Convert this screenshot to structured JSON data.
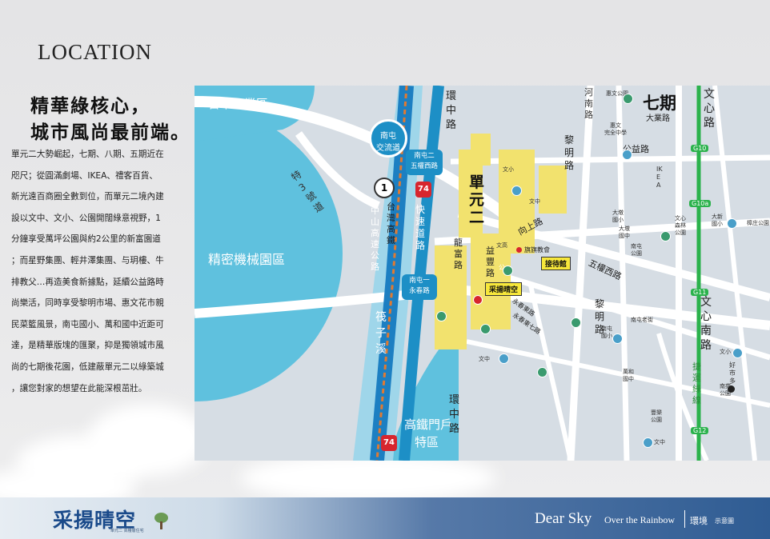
{
  "page": {
    "title": "LOCATION",
    "headline_1": "精華綠核心，",
    "headline_2": "城市風尚最前端。",
    "body_lines": [
      "單元二大勢崛起，七期、八期、五期近在",
      "咫尺；從圓滿劇場、IKEA、禮客百貨、",
      "新光遠百商圈全數到位，而單元二境內建",
      "設以文中、文小、公園開闊綠意視野，1",
      "分鐘享受萬坪公園與約2公里的新富園道",
      "；而星野集團、輕井澤集團、与玥樓、牛",
      "排教父…再造美食新據點，延續公益路時",
      "尚樂活，同時享受黎明市場、惠文花市親",
      "民菜籃風景，南屯國小、萬和國中近距可",
      "達，是精華版塊的匯聚，抑是獨領城市風",
      "尚的七期後花園，低建蔽單元二以綠築城",
      "，讓您對家的想望在此能深根茁壯。"
    ]
  },
  "map": {
    "zones": {
      "industrial": "台中工業區",
      "machinery": "精密機械園區",
      "hsr": "高鐵門戶",
      "hsr_2": "特區",
      "unit2": "單元二",
      "phase7": "七期"
    },
    "interchange": [
      "南屯",
      "交流道"
    ],
    "roads": {
      "special3": "特3號道",
      "zhongshan": "中山高速公路",
      "hsr_line": "台灣高鐵",
      "expressway": "快速道路",
      "huanzhong": "環中路",
      "huanzhong_lower": "環中路",
      "henan": "河南路",
      "wuquan_w": "五權西路",
      "liming": "黎明路",
      "wenxin_top": "文心路",
      "wenxin_bottom": "文心南路",
      "metro": "捷運綠線",
      "gongyi": "公益路",
      "dadun": "大業路",
      "xiangshang": "向上路",
      "longfu": "龍富路",
      "yifeng": "益豐路",
      "yongchun_e": "永春東路",
      "yongchun_e7": "永春東七路",
      "stream": "筏子溪"
    },
    "ramps": {
      "nt2": [
        "南屯二",
        "五權西路"
      ],
      "nt1": [
        "南屯一",
        "永春路"
      ]
    },
    "shields": {
      "highway_1": "1",
      "highway_74": "74",
      "highway_74_b": "74"
    },
    "metro_stations": [
      "G10",
      "G10a",
      "G11",
      "G12"
    ],
    "pois": {
      "huiwen_park": "惠文公園",
      "huiwen_school": [
        "惠文",
        "完全中學"
      ],
      "ikea": "IKEA",
      "dadun_elem": [
        "大墩",
        "國小"
      ],
      "dadun_mid": [
        "大墩",
        "國中"
      ],
      "wenxin_forest": [
        "文心",
        "森林",
        "公園"
      ],
      "daxin_elem": [
        "大新",
        "國小"
      ],
      "keli_park": "樟庄公園",
      "nantun_park": [
        "南屯",
        "公園"
      ],
      "nantun_old": "南屯老街",
      "nantun_elem": [
        "南屯",
        "國小"
      ],
      "wanhe_mid": [
        "萬和",
        "國中"
      ],
      "nanyuan_park": [
        "南苑",
        "公園"
      ],
      "fengle_park": [
        "豐樂",
        "公園"
      ],
      "haoshi": "好市多",
      "church": "旗旗教會",
      "wenxiao": "文小",
      "wenzhong": "文中",
      "gong": "公",
      "wenjiao": "文高",
      "reception": "接待館",
      "project": "采揚晴空"
    },
    "colors": {
      "road_yellow": "#f2e26e",
      "water": "#5fc1de",
      "bg": "#d6dde4",
      "metro": "#2bb24c",
      "ramp": "#1d8fc6",
      "shield_red": "#d7262e"
    }
  },
  "footer": {
    "logo": "采揚晴空",
    "logo_sub": "單元二 高樓層住宅",
    "tagline": "Dear Sky",
    "tagline_2": "Over the Rainbow",
    "section": "環境",
    "section_sub": "示意圖"
  }
}
